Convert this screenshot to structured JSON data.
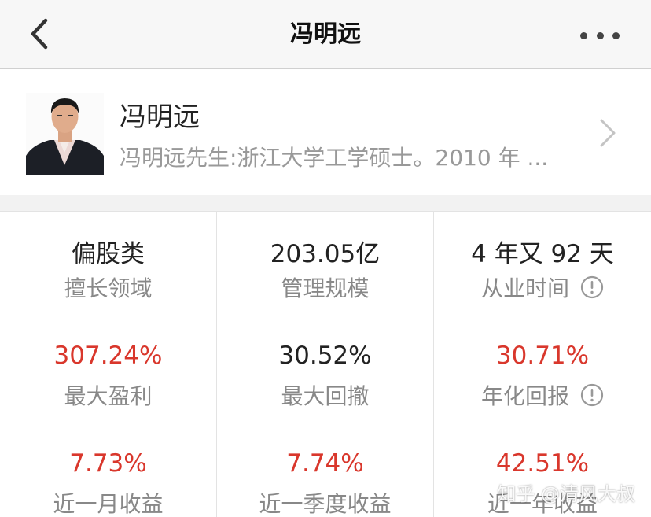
{
  "nav": {
    "title": "冯明远",
    "back_icon": "chevron-left-icon",
    "more_icon": "more-horizontal-icon"
  },
  "profile": {
    "name": "冯明远",
    "bio": "冯明远先生:浙江大学工学硕士。2010 年 ...",
    "chevron_icon": "chevron-right-icon"
  },
  "stats": [
    {
      "value": "偏股类",
      "label": "擅长领域",
      "value_color": "#222222"
    },
    {
      "value": "203.05亿",
      "label": "管理规模",
      "value_color": "#222222"
    },
    {
      "value": "4 年又 92 天",
      "label": "从业时间",
      "value_color": "#222222",
      "info_icon": "info-circle-icon"
    },
    {
      "value": "307.24%",
      "label": "最大盈利",
      "value_color": "#d9372c"
    },
    {
      "value": "30.52%",
      "label": "最大回撤",
      "value_color": "#222222"
    },
    {
      "value": "30.71%",
      "label": "年化回报",
      "value_color": "#d9372c",
      "info_icon": "info-circle-icon"
    },
    {
      "value": "7.73%",
      "label": "近一月收益",
      "value_color": "#d9372c"
    },
    {
      "value": "7.74%",
      "label": "近一季度收益",
      "value_color": "#d9372c"
    },
    {
      "value": "42.51%",
      "label": "近一年收益",
      "value_color": "#d9372c"
    }
  ],
  "watermark": "知乎 @清风大叔"
}
